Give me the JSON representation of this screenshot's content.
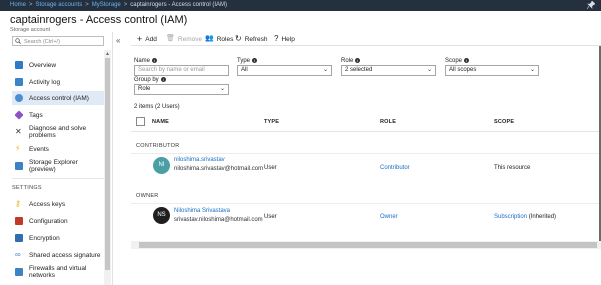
{
  "breadcrumb": [
    {
      "label": "Home",
      "link": true
    },
    {
      "label": "Storage accounts",
      "link": true
    },
    {
      "label": "MyStorage",
      "link": true
    },
    {
      "label": "captainrogers - Access control (IAM)",
      "link": false
    }
  ],
  "page": {
    "title": "captainrogers - Access control (IAM)",
    "subtitle": "Storage account"
  },
  "sidebar": {
    "search_placeholder": "Search (Ctrl+/)",
    "collapse_glyph": "«",
    "items": [
      {
        "label": "Overview",
        "icon": "overview-icon",
        "color": "#2f7ac6"
      },
      {
        "label": "Activity log",
        "icon": "activity-log-icon",
        "color": "#3d84c6"
      },
      {
        "label": "Access control (IAM)",
        "icon": "iam-people-icon",
        "color": "#4c8fd0",
        "active": true
      },
      {
        "label": "Tags",
        "icon": "tag-icon",
        "color": "#8b53c2"
      },
      {
        "label": "Diagnose and solve problems",
        "icon": "tools-icon",
        "color": "#333333"
      },
      {
        "label": "Events",
        "icon": "lightning-icon",
        "color": "#f2b21c"
      },
      {
        "label": "Storage Explorer (preview)",
        "icon": "storage-explorer-icon",
        "color": "#3c83c4"
      }
    ],
    "section_settings": "SETTINGS",
    "settings_items": [
      {
        "label": "Access keys",
        "icon": "key-icon",
        "color": "#e7b21a"
      },
      {
        "label": "Configuration",
        "icon": "configuration-icon",
        "color": "#c0392b"
      },
      {
        "label": "Encryption",
        "icon": "lock-icon",
        "color": "#2f6fb0"
      },
      {
        "label": "Shared access signature",
        "icon": "link-icon",
        "color": "#3c83c4"
      },
      {
        "label": "Firewalls and virtual networks",
        "icon": "firewall-icon",
        "color": "#3c83c4"
      }
    ]
  },
  "toolbar": {
    "add_label": "Add",
    "remove_label": "Remove",
    "roles_label": "Roles",
    "refresh_label": "Refresh",
    "help_label": "Help"
  },
  "filters": {
    "name_label": "Name",
    "name_placeholder": "Search by name or email",
    "type_label": "Type",
    "type_value": "All",
    "role_label": "Role",
    "role_value": "2 selected",
    "scope_label": "Scope",
    "scope_value": "All scopes",
    "groupby_label": "Group by",
    "groupby_value": "Role"
  },
  "results": {
    "count_text": "2 items (2 Users)",
    "columns": [
      "NAME",
      "TYPE",
      "ROLE",
      "SCOPE"
    ],
    "groups": [
      {
        "label": "CONTRIBUTOR",
        "rows": [
          {
            "initials": "NI",
            "avatar_color": "#4a9fa5",
            "name": "niloshima.srivastav",
            "email": "niloshima.srivastav@hotmail.com",
            "type": "User",
            "role": "Contributor",
            "scope": "This resource",
            "scope_link": ""
          }
        ]
      },
      {
        "label": "OWNER",
        "rows": [
          {
            "initials": "NS",
            "avatar_color": "#1f1f1f",
            "name": "Niloshima Srivastava",
            "email": "srivastav.niloshima@hotmail.com",
            "type": "User",
            "role": "Owner",
            "scope": " (Inherited)",
            "scope_link": "Subscription"
          }
        ]
      }
    ]
  }
}
